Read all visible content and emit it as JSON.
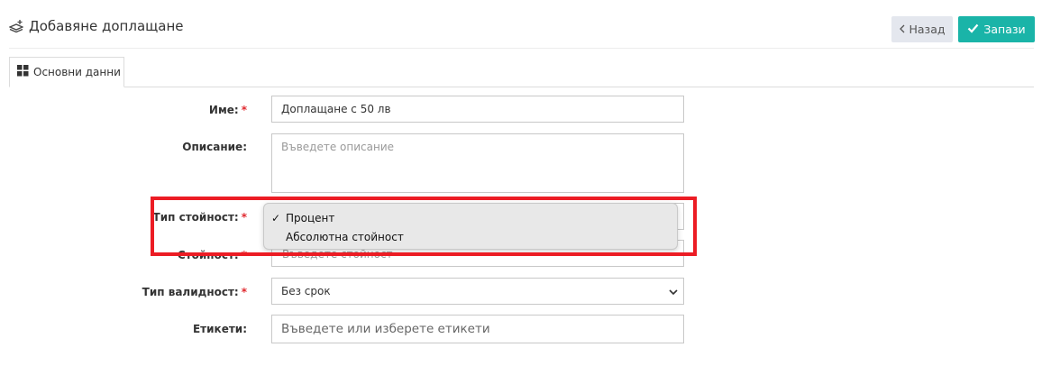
{
  "header": {
    "title": "Добавяне доплащане",
    "back_label": "Назад",
    "save_label": "Запази"
  },
  "tabs": [
    {
      "label": "Основни данни",
      "active": true
    }
  ],
  "form": {
    "name": {
      "label": "Име:",
      "required": "*",
      "value": "Доплащане с 50 лв"
    },
    "description": {
      "label": "Описание:",
      "placeholder": "Въведете описание"
    },
    "value_type": {
      "label": "Тип стойност:",
      "required": "*",
      "options": [
        "Процент",
        "Абсолютна стойност"
      ],
      "selected": "Процент",
      "check_mark": "✓"
    },
    "value": {
      "label": "Стойност:",
      "required": "*",
      "placeholder": "Въведете стойност"
    },
    "validity_type": {
      "label": "Тип валидност:",
      "required": "*",
      "selected": "Без срок"
    },
    "tags": {
      "label": "Етикети:",
      "placeholder": "Въведете или изберете етикети"
    }
  },
  "colors": {
    "accent": "#1ab4a8",
    "back_button_bg": "#e4e7ee",
    "required": "#e0282e",
    "highlight": "#ec1c24"
  },
  "icons": {
    "title": "layers-plus-icon",
    "back": "chevron-left-icon",
    "save": "check-icon",
    "tab": "grid-icon",
    "select": "chevron-down-icon"
  }
}
